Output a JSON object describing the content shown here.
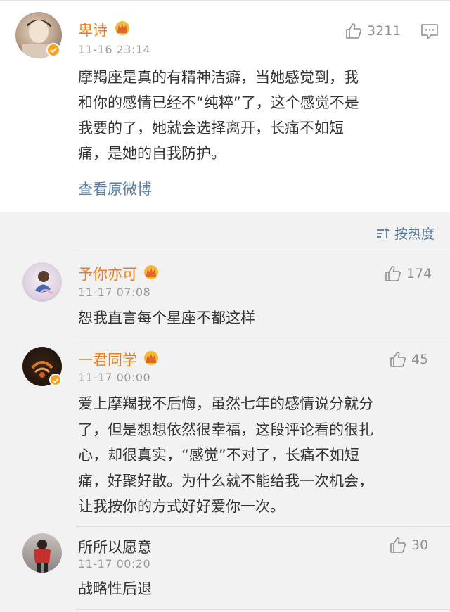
{
  "top_comment": {
    "username": "卑诗",
    "timestamp": "11-16 23:14",
    "like_count": "3211",
    "text_lines": [
      "摩羯座是真的有精神洁癖，当她感觉到，我",
      "和你的感情已经不“纯粹”了，这个感觉不是",
      "我要的了，她就会选择离开，长痛不如短",
      "痛，是她的自我防护。"
    ],
    "view_original_label": "查看原微博"
  },
  "sort": {
    "label": "按热度"
  },
  "replies": [
    {
      "username": "予你亦可",
      "timestamp": "11-17 07:08",
      "like_count": "174",
      "text_lines": [
        "恕我直言每个星座不都这样"
      ]
    },
    {
      "username": "一君同学",
      "timestamp": "11-17 00:00",
      "like_count": "45",
      "text_lines": [
        "爱上摩羯我不后悔，虽然七年的感情说分就分",
        "了，但是想想依然很幸福，这段评论看的很扎",
        "心，却很真实，“感觉”不对了，长痛不如短",
        "痛，好聚好散。为什么就不能给我一次机会，",
        "让我按你的方式好好爱你一次。"
      ]
    },
    {
      "username": "所所以愿意",
      "timestamp": "11-17 00:20",
      "like_count": "30",
      "text_lines": [
        "战略性后退"
      ]
    }
  ],
  "colors": {
    "vip_name": "#ea7e23",
    "link": "#5a7fa6",
    "meta": "#9b9b9b",
    "background": "#f2f2f2"
  },
  "icons": [
    "thumbs-up-icon",
    "comment-icon",
    "crown-badge-icon",
    "verified-badge-icon",
    "sort-icon"
  ]
}
